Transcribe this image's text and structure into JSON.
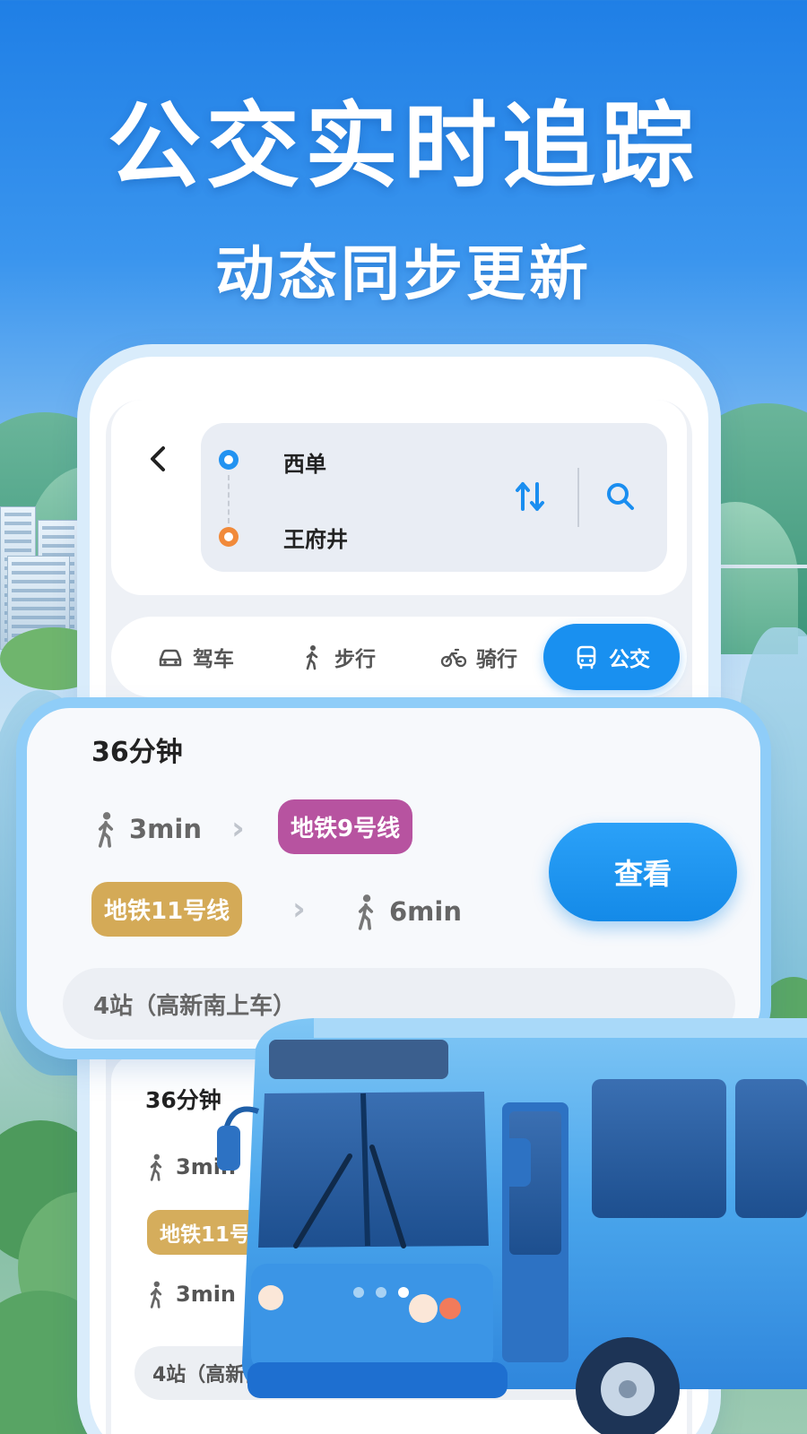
{
  "headline": "公交实时追踪",
  "subline": "动态同步更新",
  "search": {
    "start": "西单",
    "end": "王府井"
  },
  "modes": [
    {
      "label": "驾车",
      "icon": "car-icon"
    },
    {
      "label": "步行",
      "icon": "walk-icon"
    },
    {
      "label": "骑行",
      "icon": "bike-icon"
    },
    {
      "label": "公交",
      "icon": "bus-icon",
      "active": true
    }
  ],
  "route_main": {
    "duration": "36分钟",
    "walk_first": "3min",
    "line_a": "地铁9号线",
    "line_b": "地铁11号线",
    "walk_last": "6min",
    "view_label": "查看",
    "stops": "4站（高新南上车）"
  },
  "route_second": {
    "duration": "36分钟",
    "walk_first": "3min",
    "line_b": "地铁11号",
    "walk_last": "3min",
    "stops": "4站（高新南上车）"
  },
  "colors": {
    "accent": "#1990f0",
    "line_9": "#b753a0",
    "line_11": "#d4aa57",
    "start_dot": "#2393f1",
    "end_dot": "#f18a3a"
  }
}
